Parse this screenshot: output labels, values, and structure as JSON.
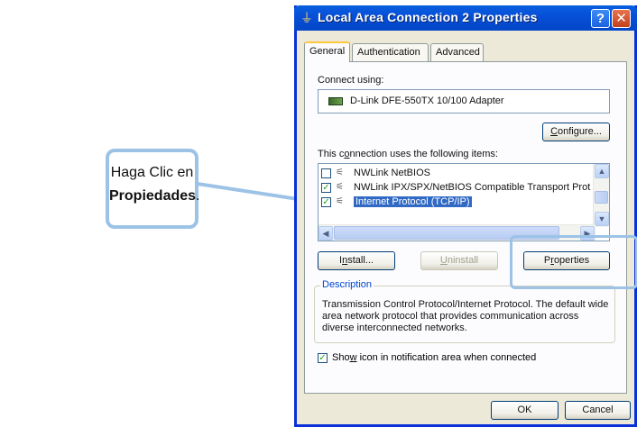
{
  "callout": {
    "line1": "Haga Clic en",
    "bold": "Propiedades",
    "suffix": "."
  },
  "window": {
    "title": "Local Area Connection 2 Properties",
    "help_label": "?",
    "close_label": "✕"
  },
  "tabs": [
    {
      "label": "General",
      "active": true
    },
    {
      "label": "Authentication"
    },
    {
      "label": "Advanced"
    }
  ],
  "connect_using": {
    "label_pre": "Connect using:",
    "adapter": "D-Link DFE-550TX 10/100 Adapter",
    "configure_pre": "",
    "configure_u": "C",
    "configure_post": "onfigure..."
  },
  "items_label": {
    "pre": "This c",
    "u": "o",
    "post": "nnection uses the following items:"
  },
  "items": [
    {
      "label": "NWLink NetBIOS",
      "checked": false,
      "selected": false
    },
    {
      "label": "NWLink IPX/SPX/NetBIOS Compatible Transport Prot",
      "checked": true,
      "selected": false
    },
    {
      "label": "Internet Protocol (TCP/IP)",
      "checked": true,
      "selected": true
    }
  ],
  "buttons": {
    "install": {
      "pre": "I",
      "u": "n",
      "post": "stall..."
    },
    "uninstall": {
      "pre": "",
      "u": "U",
      "post": "ninstall"
    },
    "properties": {
      "pre": "P",
      "u": "r",
      "post": "operties"
    },
    "ok": "OK",
    "cancel": "Cancel"
  },
  "description": {
    "title": "Description",
    "text": "Transmission Control Protocol/Internet Protocol. The default wide area network protocol that provides communication across diverse interconnected networks."
  },
  "notify": {
    "pre": "Sho",
    "u": "w",
    "post": " icon in notification area when connected",
    "checked": true
  },
  "colors": {
    "accent": "#0831d9",
    "callout_border": "#9cc3e6",
    "selection": "#316ac5"
  }
}
